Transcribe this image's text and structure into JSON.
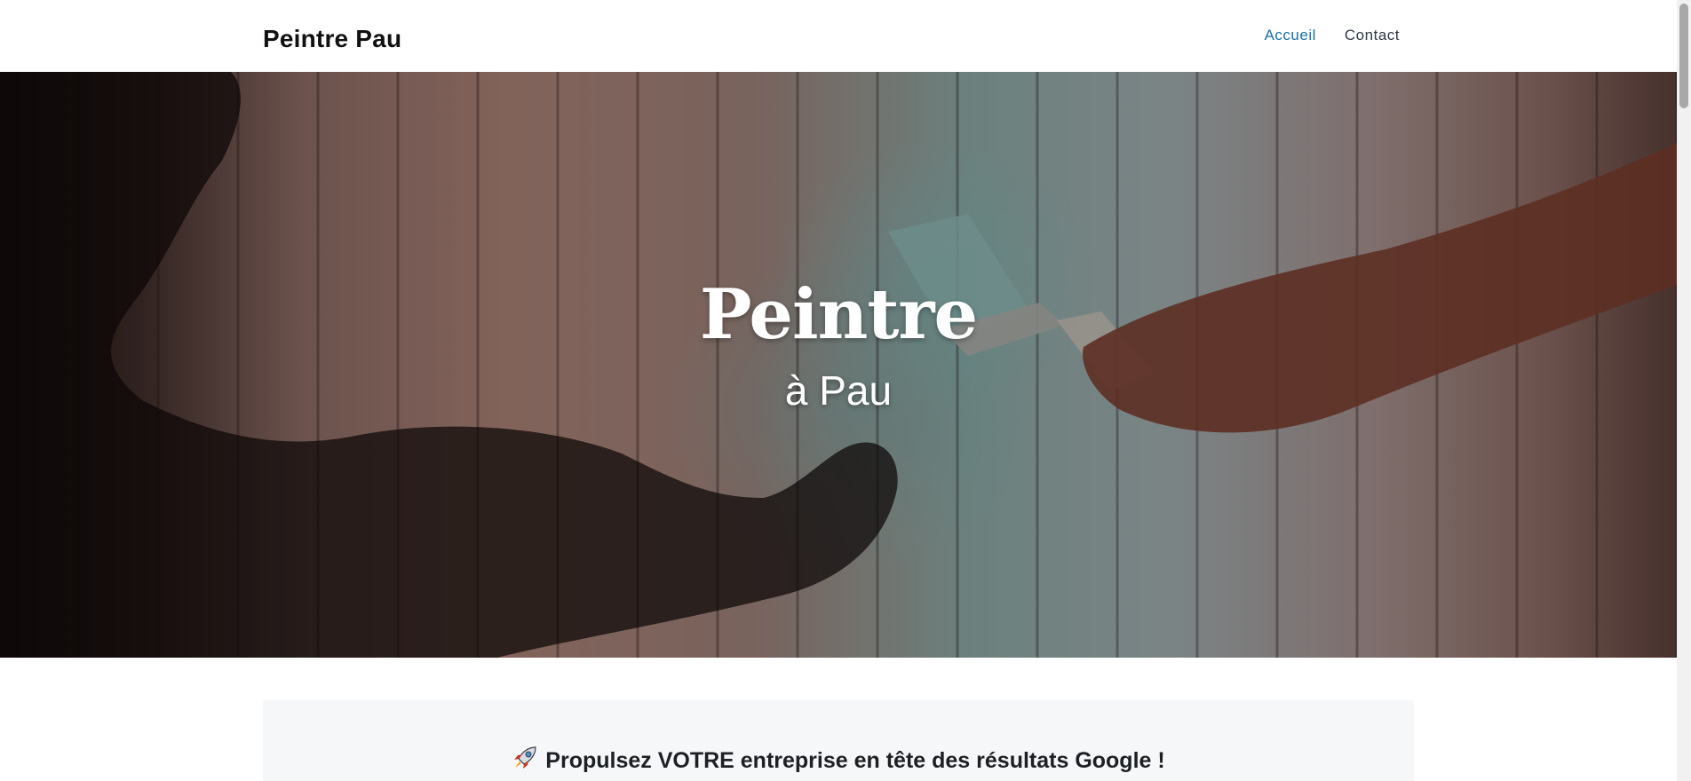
{
  "header": {
    "site_title": "Peintre Pau",
    "nav": [
      {
        "label": "Accueil",
        "active": true
      },
      {
        "label": "Contact",
        "active": false
      }
    ]
  },
  "hero": {
    "title": "Peintre",
    "subtitle": "à Pau"
  },
  "promo": {
    "icon": "rocket-icon",
    "title": "Propulsez VOTRE entreprise en tête des résultats Google !"
  },
  "colors": {
    "nav_active": "#1b6fa8",
    "nav_default": "#2f3a44",
    "promo_bg": "#f6f7f8"
  }
}
